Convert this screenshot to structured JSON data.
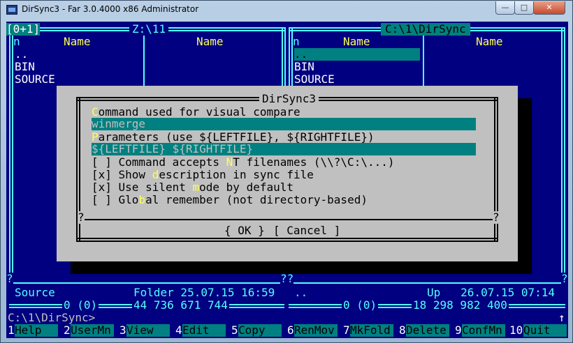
{
  "window": {
    "title": "DirSync3 - Far 3.0.4000 x86 Administrator",
    "buttons": {
      "minimize": "—",
      "maximize": "□",
      "close": "✕"
    }
  },
  "left_panel": {
    "indicator": "[0+1]",
    "path": "Z:\\11",
    "col_n": "n",
    "col_name": "Name",
    "col_name2": "Name",
    "items": [
      "..",
      "BIN",
      "SOURCE"
    ],
    "status_left": "Source",
    "status_right": "Folder 25.07.15 16:59",
    "totals_count": "0 (0)",
    "totals_size": "44 736 671 744"
  },
  "right_panel": {
    "path": "C:\\1\\DirSync",
    "col_n": "n",
    "col_name": "Name",
    "col_name2": "Name",
    "items": [
      "..",
      "BIN",
      "SOURCE"
    ],
    "status_left": "..",
    "status_right": "Up   26.07.15 07:14",
    "totals_count": "0 (0)",
    "totals_size": "18 298 982 400"
  },
  "markers": {
    "q": "?",
    "qq": "??"
  },
  "dialog": {
    "title": "DirSync3",
    "command_label_hot": "C",
    "command_label_rest": "ommand used for visual compare",
    "command_value": "winmerge",
    "params_label_hot": "P",
    "params_label_rest": "arameters (use ${LEFTFILE}, ${RIGHTFILE})",
    "params_value": "${LEFTFILE} ${RIGHTFILE}",
    "opt1_a": "[ ] Command accepts ",
    "opt1_hot": "N",
    "opt1_b": "T filenames (\\\\?\\C:\\...)",
    "opt2_a": "[x] Show ",
    "opt2_hot": "d",
    "opt2_b": "escription in sync file",
    "opt3_a": "[x] Use silent ",
    "opt3_hot": "m",
    "opt3_b": "ode by default",
    "opt4_a": "[ ] Glo",
    "opt4_hot": "b",
    "opt4_b": "al remember (not directory-based)",
    "ok": "{ OK }",
    "cancel": "[ Cancel ]"
  },
  "command_line": {
    "prompt": "C:\\1\\DirSync>",
    "arrow": "↑"
  },
  "fkeys": [
    {
      "num": "1",
      "label": "Help"
    },
    {
      "num": "2",
      "label": "UserMn"
    },
    {
      "num": "3",
      "label": "View"
    },
    {
      "num": "4",
      "label": "Edit"
    },
    {
      "num": "5",
      "label": "Copy"
    },
    {
      "num": "6",
      "label": "RenMov"
    },
    {
      "num": "7",
      "label": "MkFold"
    },
    {
      "num": "8",
      "label": "Delete"
    },
    {
      "num": "9",
      "label": "ConfMn"
    },
    {
      "num": "10",
      "label": "Quit"
    }
  ],
  "colors": {
    "panel_bg": "#000080",
    "frame": "#55ffff",
    "dialog_bg": "#c0c0c0",
    "field_bg": "#008080",
    "highlight": "#ffff55"
  }
}
